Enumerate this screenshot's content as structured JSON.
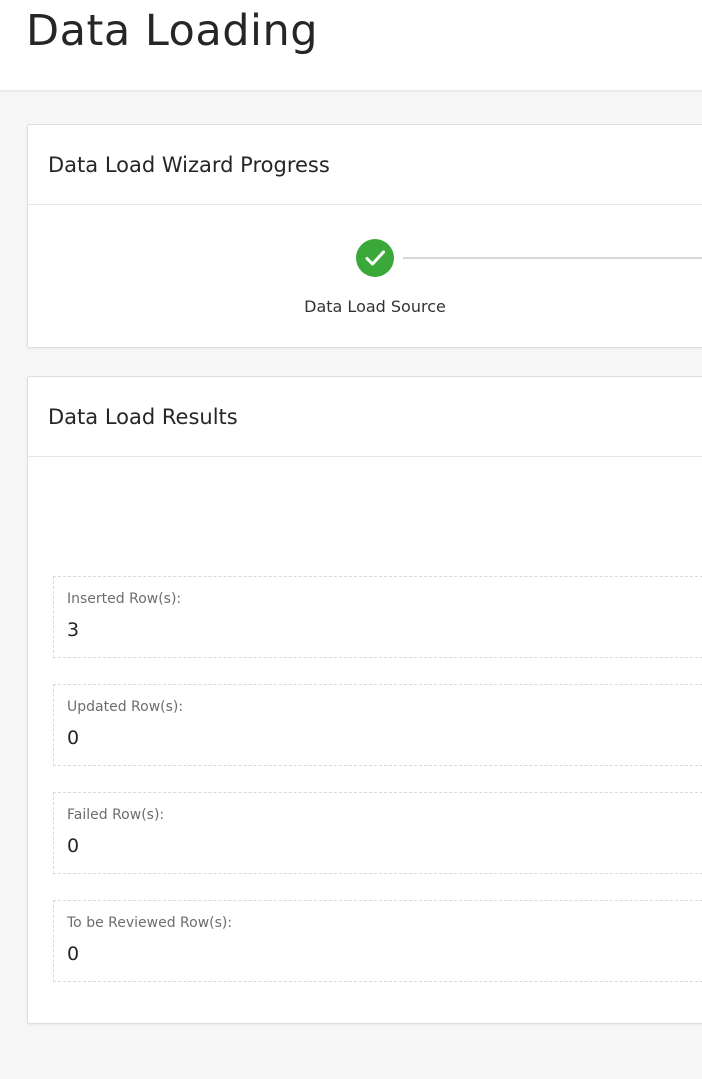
{
  "page": {
    "title": "Data Loading"
  },
  "wizard": {
    "title": "Data Load Wizard Progress",
    "steps": [
      {
        "label": "Data Load Source",
        "status": "complete",
        "icon": "check-icon",
        "color": "#3aa93a"
      }
    ]
  },
  "results": {
    "title": "Data Load Results",
    "items": [
      {
        "label": "Inserted Row(s):",
        "value": "3"
      },
      {
        "label": "Updated Row(s):",
        "value": "0"
      },
      {
        "label": "Failed Row(s):",
        "value": "0"
      },
      {
        "label": "To be Reviewed Row(s):",
        "value": "0"
      }
    ]
  }
}
